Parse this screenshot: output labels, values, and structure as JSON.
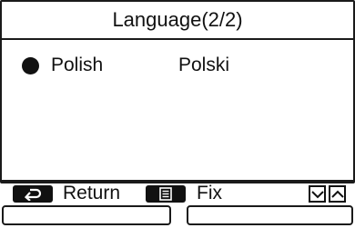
{
  "header": {
    "title": "Language(2/2)"
  },
  "list": {
    "items": [
      {
        "label": "Polish",
        "native": "Polski",
        "selected": true
      }
    ]
  },
  "footer": {
    "return_icon": "return-arrow-icon",
    "return_label": "Return",
    "menu_icon": "menu-list-icon",
    "fix_label": "Fix",
    "down_icon": "chevron-down-icon",
    "up_icon": "chevron-up-icon"
  },
  "colors": {
    "foreground": "#111111",
    "background": "#ffffff"
  }
}
